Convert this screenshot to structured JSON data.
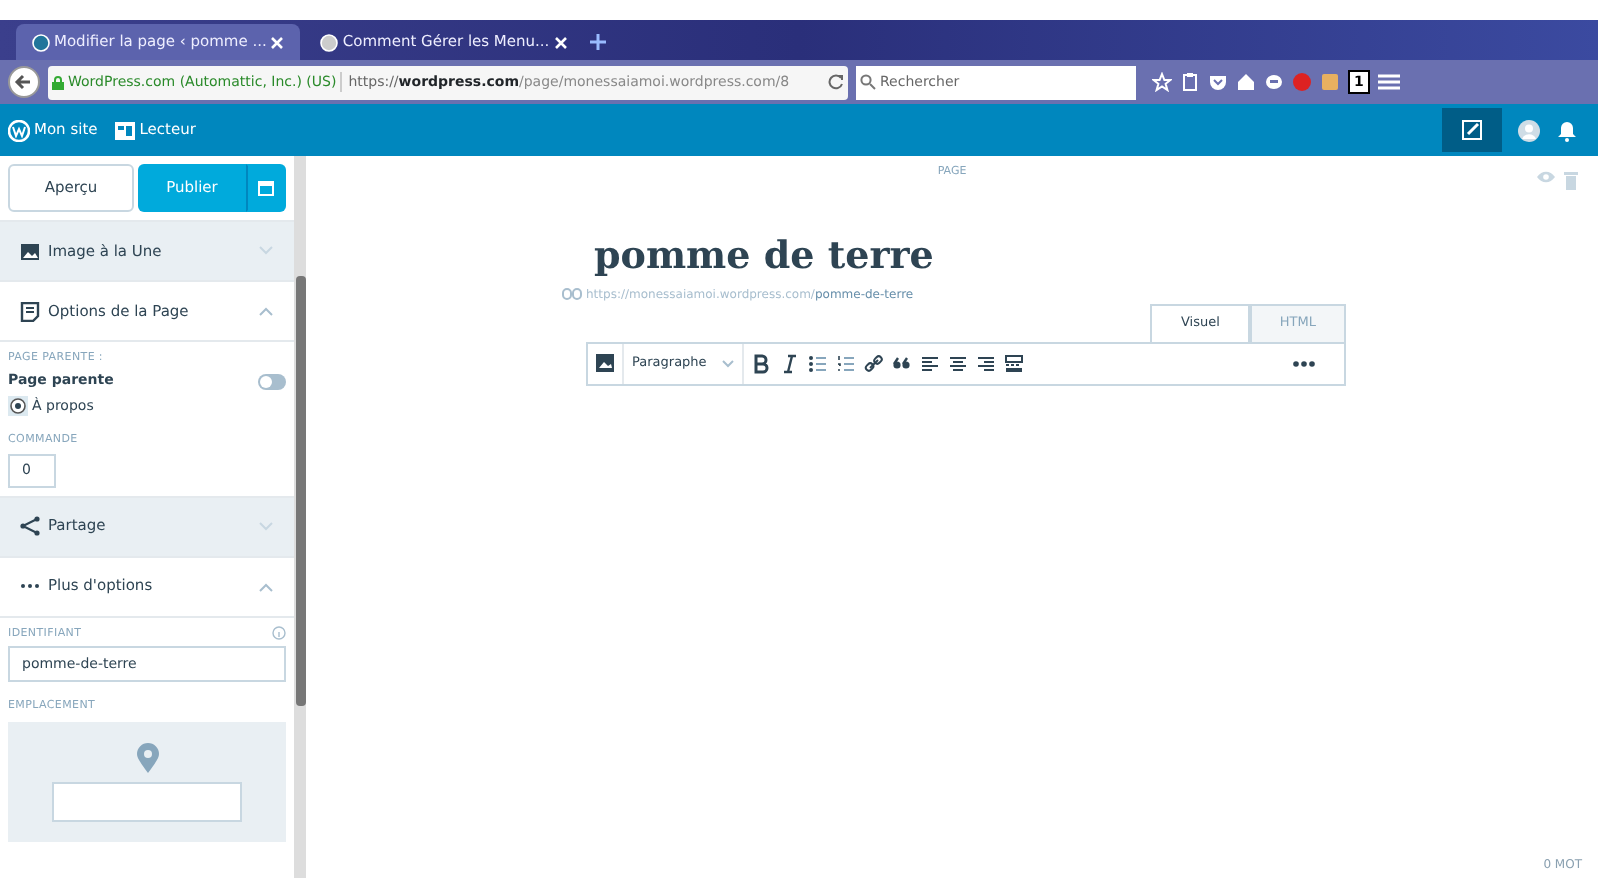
{
  "browser": {
    "tabs": [
      {
        "title": "Modifier la page ‹ pomme ...",
        "selected": true
      },
      {
        "title": "Comment Gérer les Menu...",
        "selected": false
      }
    ],
    "identity": "WordPress.com (Automattic, Inc.) (US)",
    "url_prefix": "https://",
    "url_domain": "wordpress.com",
    "url_path": "/page/monessaiamoi.wordpress.com/8",
    "search_placeholder": "Rechercher",
    "badge": "1"
  },
  "masterbar": {
    "items": [
      "Mon site",
      "Lecteur"
    ]
  },
  "sidebar": {
    "preview": "Aperçu",
    "publish": "Publier",
    "sections": [
      {
        "label": "Image à la Une",
        "expanded": false
      },
      {
        "label": "Options de la Page",
        "expanded": true
      },
      {
        "label": "Partage",
        "expanded": false
      },
      {
        "label": "Plus d'options",
        "expanded": true
      }
    ],
    "parent_heading": "PAGE PARENTE :",
    "parent_toggle": {
      "label": "Page parente",
      "on": false
    },
    "parent_choice": {
      "label": "À propos",
      "selected": true
    },
    "order_label": "COMMANDE",
    "order_value": "0",
    "slug_label": "IDENTIFIANT",
    "slug_value": "pomme-de-terre",
    "location_label": "EMPLACEMENT"
  },
  "editor": {
    "kind_label": "PAGE",
    "title": "pomme de terre",
    "permalink_base": "https://monessaiamoi.wordpress.com/",
    "permalink_slug": "pomme-de-terre",
    "tabs": [
      {
        "label": "Visuel",
        "selected": true
      },
      {
        "label": "HTML",
        "selected": false
      }
    ],
    "format": "Paragraphe",
    "word_count": "0 MOT"
  }
}
